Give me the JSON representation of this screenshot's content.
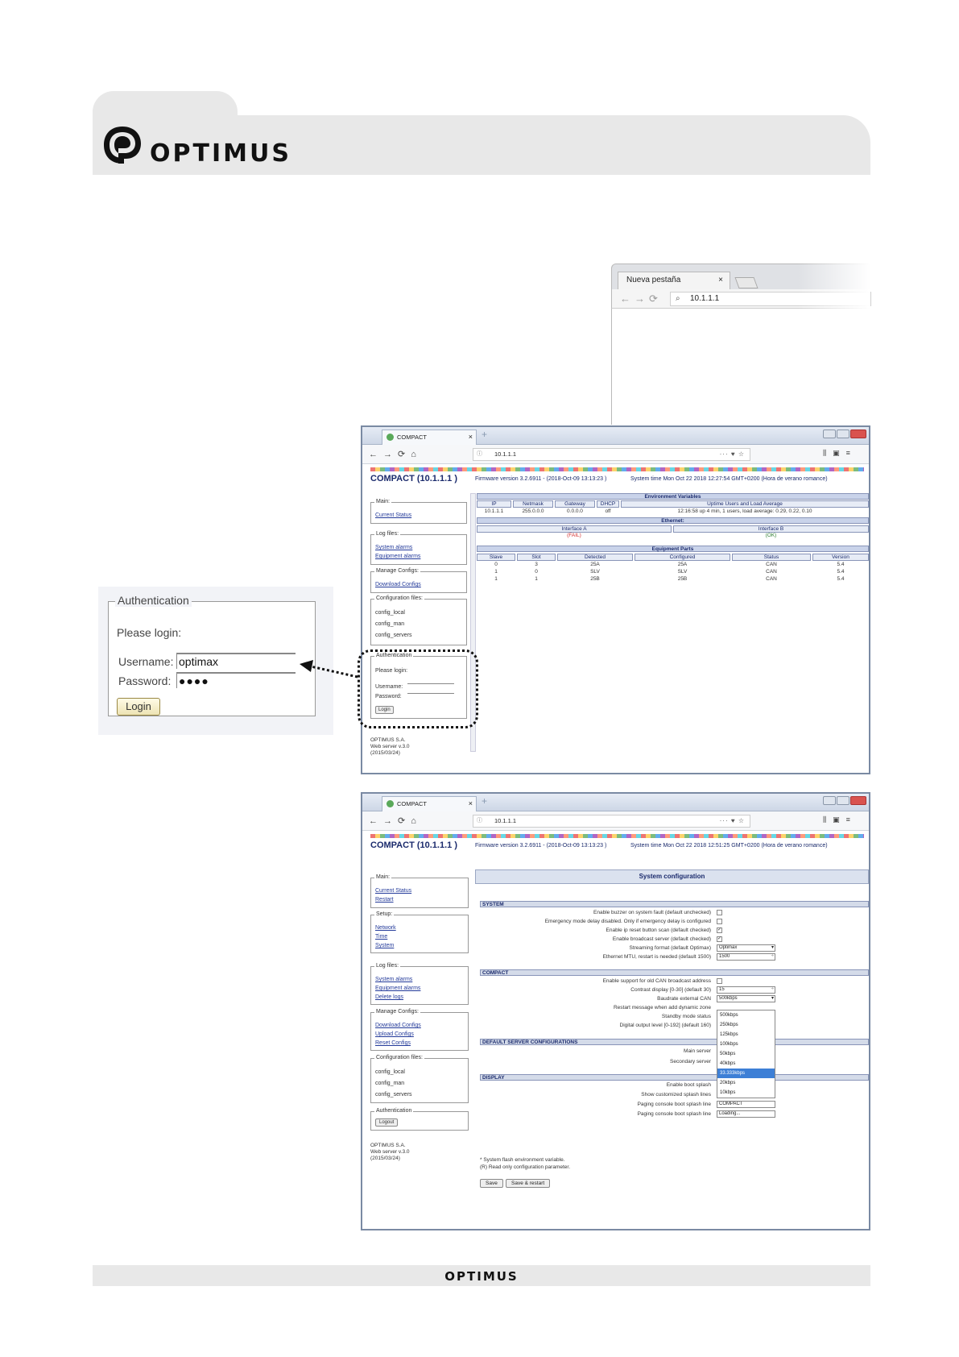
{
  "header": {
    "brand": "OPTIMUS",
    "logo": "optimus-logo-icon"
  },
  "footer": {
    "brand": "OPTIMUS"
  },
  "browser_snippet": {
    "tab_label": "Nueva pestaña",
    "tab_close": "×",
    "url": "10.1.1.1"
  },
  "window1": {
    "tab_label": "COMPACT",
    "tab_close": "×",
    "url": "10.1.1.1",
    "heading": "COMPACT (10.1.1.1 )",
    "firmware": "Firmware version 3.2.6911 - (2018-Oct-09 13:13:23 )",
    "system_time": "System time Mon Oct 22 2018 12:27:54 GMT+0200 (Hora de verano romance)",
    "sidebar": {
      "main_legend": "Main:",
      "current_status": "Current Status",
      "log_legend": "Log files:",
      "system_alarms": "System alarms",
      "equipment_alarms": "Equipment alarms",
      "manage_legend": "Manage Configs:",
      "download_configs": "Download Configs",
      "config_legend": "Configuration files:",
      "config_local": "config_local",
      "config_man": "config_man",
      "config_servers": "config_servers",
      "auth_legend": "Authentication",
      "please_login": "Please login:",
      "username_label": "Username:",
      "password_label": "Password:",
      "login_button": "Login",
      "footer": "OPTIMUS S.A.\nWeb server v.3.0\n(2015/03/24)"
    },
    "env_title": "Environment Variables",
    "env_headers": [
      "IP",
      "Netmask",
      "Gateway",
      "DHCP",
      "Uptime Users and Load Average"
    ],
    "env_row": [
      "10.1.1.1",
      "255.0.0.0",
      "0.0.0.0",
      "off",
      "12:16:58 up 4 min, 1 users, load average: 0.29, 0.22, 0.10"
    ],
    "eth_title": "Ethernet:",
    "eth_headers": [
      "Interface A",
      "Interface B"
    ],
    "eth_row": [
      "(FAIL)",
      "(OK)"
    ],
    "parts_title": "Equipment Parts",
    "parts_headers": [
      "Slave",
      "Slot",
      "Detected",
      "Configured",
      "Status",
      "Version"
    ],
    "parts_rows": [
      [
        "0",
        "3",
        "25A",
        "25A",
        "CAN",
        "5.4"
      ],
      [
        "1",
        "0",
        "SLV",
        "SLV",
        "CAN",
        "5.4"
      ],
      [
        "1",
        "1",
        "25B",
        "25B",
        "CAN",
        "5.4"
      ]
    ]
  },
  "auth_zoom": {
    "legend": "Authentication",
    "please_login": "Please login:",
    "username_label": "Username:",
    "username_value": "optimax",
    "password_label": "Password:",
    "password_value": "●●●●",
    "login_button": "Login"
  },
  "window2": {
    "tab_label": "COMPACT",
    "tab_close": "×",
    "url": "10.1.1.1",
    "heading": "COMPACT (10.1.1.1 )",
    "firmware": "Firmware version 3.2.6911 - (2018-Oct-09 13:13:23 )",
    "system_time": "System time Mon Oct 22 2018 12:51:25 GMT+0200 (Hora de verano romance)",
    "sidebar": {
      "main_legend": "Main:",
      "current_status": "Current Status",
      "restart": "Restart",
      "setup_legend": "Setup:",
      "network": "Network",
      "time": "Time",
      "system": "System",
      "log_legend": "Log files:",
      "system_alarms": "System alarms",
      "equipment_alarms": "Equipment alarms",
      "delete_logs": "Delete logs",
      "manage_legend": "Manage Configs:",
      "download_configs": "Download Configs",
      "upload_configs": "Upload Configs",
      "reset_configs": "Reset Configs",
      "config_legend": "Configuration files:",
      "config_local": "config_local",
      "config_man": "config_man",
      "config_servers": "config_servers",
      "auth_legend": "Authentication",
      "logout_button": "Logout",
      "footer": "OPTIMUS S.A.\nWeb server v.3.0\n(2015/03/24)"
    },
    "config_title": "System configuration",
    "system_section": "SYSTEM",
    "system_fields": [
      "Enable buzzer on system fault (default unchecked)",
      "Emergency mode delay disabled. Only if emergency delay is configured",
      "Enable ip reset button scan (default checked)",
      "Enable broadcast server (default checked)",
      "Streaming format (default Optimax)",
      "Ethernet MTU, restart is needed (default 1500)"
    ],
    "system_values": {
      "streaming": "Optimax",
      "mtu": "1500"
    },
    "compact_section": "COMPACT",
    "compact_fields": [
      "Enable support for old CAN broadcast address",
      "Contrast display [0-30] (default 30)",
      "Baudrate external CAN",
      "Restart message when add dynamic zone",
      "Standby mode status",
      "Digital output level [0-192] (default 160)"
    ],
    "compact_values": {
      "contrast": "15",
      "baudrate": "500kbps"
    },
    "baud_options": [
      "500kbps",
      "250kbps",
      "125kbps",
      "100kbps",
      "50kbps",
      "40kbps",
      "33.333kbps",
      "20kbps",
      "10kbps"
    ],
    "servers_section": "DEFAULT SERVER CONFIGURATIONS",
    "servers_fields": [
      "Main server",
      "Secondary server"
    ],
    "display_section": "DISPLAY",
    "display_fields": [
      "Enable boot splash",
      "Show customized splash lines",
      "Paging console boot splash line",
      "Paging console boot splash line"
    ],
    "display_values": {
      "line1": "COMPACT",
      "line2": "Loading..."
    },
    "note1": "* System flash environment variable.",
    "note2": "(R) Read only configuration parameter.",
    "save_button": "Save",
    "save_restart_button": "Save & restart"
  }
}
